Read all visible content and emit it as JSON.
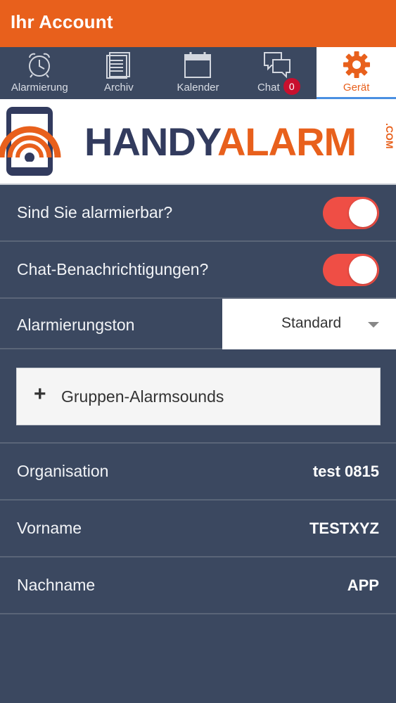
{
  "appbar": {
    "title": "Ihr Account"
  },
  "tabs": [
    {
      "label": "Alarmierung",
      "icon": "alarm-clock-icon"
    },
    {
      "label": "Archiv",
      "icon": "archive-icon"
    },
    {
      "label": "Kalender",
      "icon": "calendar-icon"
    },
    {
      "label": "Chat",
      "icon": "chat-icon",
      "badge": "0"
    },
    {
      "label": "Gerät",
      "icon": "gear-icon",
      "active": true
    }
  ],
  "logo": {
    "word1": "HANDY",
    "word2": "ALARM",
    "suffix": ".COM"
  },
  "settings": {
    "alarmable": {
      "label": "Sind Sie alarmierbar?",
      "on": true
    },
    "chat_notifications": {
      "label": "Chat-Benachrichtigungen?",
      "on": true
    },
    "alarm_tone": {
      "label": "Alarmierungston",
      "value": "Standard"
    },
    "group_sounds": {
      "label": "Gruppen-Alarmsounds",
      "icon": "plus-icon"
    }
  },
  "account": {
    "organisation": {
      "label": "Organisation",
      "value": "test 0815"
    },
    "vorname": {
      "label": "Vorname",
      "value": "TESTXYZ"
    },
    "nachname": {
      "label": "Nachname",
      "value": "APP"
    }
  },
  "colors": {
    "brand_orange": "#e8601c",
    "navy": "#3b4860",
    "toggle_on": "#ef4e45",
    "badge": "#c8102e"
  }
}
